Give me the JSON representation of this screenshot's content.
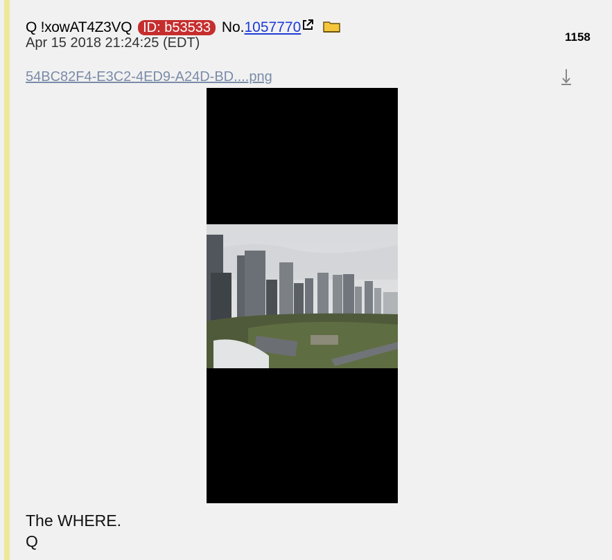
{
  "post": {
    "name": "Q !xowAT4Z3VQ",
    "id_badge": "ID: b53533",
    "no_prefix": "No.",
    "post_number": "1057770",
    "date": "Apr 15 2018 21:24:25 (EDT)",
    "reply_count": "1158",
    "file_name": "54BC82F4-E3C2-4ED9-A24D-BD....png",
    "message_lines": [
      "The WHERE.",
      "Q"
    ],
    "icons": {
      "external_link": "external-link-icon",
      "folder": "folder-icon",
      "download": "download-icon"
    },
    "colors": {
      "background": "#f1f1f1",
      "border": "#eee89a",
      "id_badge": "#c62e2e",
      "link": "#1d3bd7",
      "file_link": "#7a8ba7"
    }
  }
}
